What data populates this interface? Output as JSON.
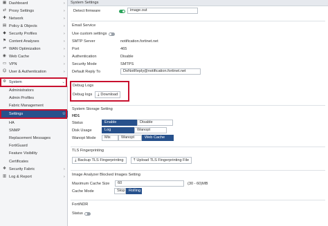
{
  "sidebar": {
    "items": [
      {
        "icon": "dashboard-icon",
        "glyph": "▦",
        "label": "Dashboard"
      },
      {
        "icon": "proxy-icon",
        "glyph": "⇄",
        "label": "Proxy Settings"
      },
      {
        "icon": "network-icon",
        "glyph": "✚",
        "label": "Network"
      },
      {
        "icon": "policy-icon",
        "glyph": "▤",
        "label": "Policy & Objects"
      },
      {
        "icon": "security-profiles-icon",
        "glyph": "◆",
        "label": "Security Profiles"
      },
      {
        "icon": "content-analyses-icon",
        "glyph": "⚑",
        "label": "Content Analyses"
      },
      {
        "icon": "wan-optimization-icon",
        "glyph": "⇌",
        "label": "WAN Optimization"
      },
      {
        "icon": "web-cache-icon",
        "glyph": "◉",
        "label": "Web Cache"
      },
      {
        "icon": "vpn-icon",
        "glyph": "▭",
        "label": "VPN"
      },
      {
        "icon": "user-icon",
        "glyph": "☺",
        "label": "User & Authentication"
      },
      {
        "icon": "system-gear-icon",
        "glyph": "⚙",
        "label": "System"
      }
    ],
    "system_subitems": [
      "Administrators",
      "Admin Profiles",
      "Fabric Management",
      "Settings",
      "HA",
      "SNMP",
      "Replacement Messages",
      "FortiGuard",
      "Feature Visibility",
      "Certificates"
    ],
    "bottom_items": [
      {
        "icon": "security-fabric-icon",
        "glyph": "❖",
        "label": "Security Fabric"
      },
      {
        "icon": "log-report-icon",
        "glyph": "▥",
        "label": "Log & Report"
      }
    ]
  },
  "main": {
    "system_settings": {
      "header": "System Settings",
      "detect_firmware_label": "Detect firmware",
      "detect_firmware_value": "image.out"
    },
    "email_service": {
      "title": "Email Service",
      "custom_settings_label": "Use custom settings",
      "smtp_server_label": "SMTP Server",
      "smtp_server_value": "notification.fortinet.net",
      "port_label": "Port",
      "port_value": "465",
      "auth_label": "Authentication",
      "auth_value": "Disable",
      "security_mode_label": "Security Mode",
      "security_mode_value": "SMTPS",
      "reply_to_label": "Default Reply To",
      "reply_to_value": "DoNotReply@notification.fortinet.net"
    },
    "debug_logs": {
      "title": "Debug Logs",
      "label": "Debug logs",
      "button": "Download"
    },
    "system_storage": {
      "title": "System Storage Setting",
      "disk": "HD1",
      "status_label": "Status",
      "status_options": [
        "Enable",
        "Disable"
      ],
      "disk_usage_label": "Disk Usage",
      "disk_usage_options": [
        "Log",
        "Wanopt"
      ],
      "wanopt_mode_label": "Wanopt Mode",
      "wanopt_mode_options": [
        "Mix",
        "Wanopt",
        "Web Cache"
      ]
    },
    "tls": {
      "title": "TLS Fingerprinting",
      "backup_button": "Backup TLS Fingerprinting",
      "upload_button": "Upload TLS Fingerprinting File"
    },
    "image_analyzer": {
      "title": "Image Analyzer Blocked Images Setting",
      "max_cache_label": "Maximum Cache Size",
      "max_cache_value": "60",
      "max_cache_hint": "(30 - 60)MB",
      "cache_mode_label": "Cache Mode",
      "cache_mode_options": [
        "Stop",
        "Rolling"
      ]
    },
    "fortindr": {
      "title": "FortiNDR",
      "status_label": "Status"
    }
  },
  "colors": {
    "accent": "#27518c",
    "highlight": "#c8102e",
    "toggle_on": "#2ba35b"
  }
}
